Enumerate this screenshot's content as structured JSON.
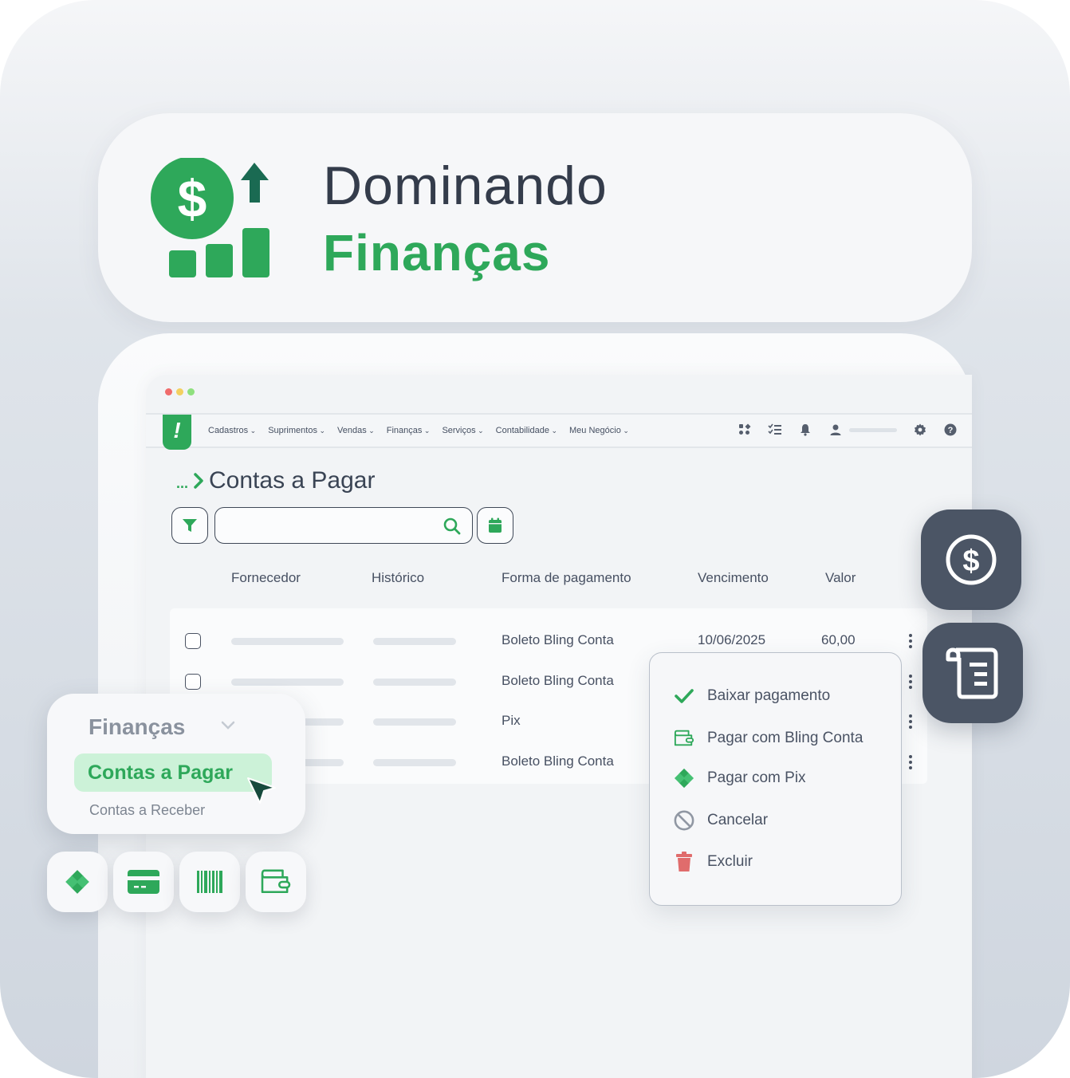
{
  "hero": {
    "title_line1": "Dominando",
    "title_line2": "Finanças"
  },
  "window": {
    "nav": [
      "Cadastros",
      "Suprimentos",
      "Vendas",
      "Finanças",
      "Serviços",
      "Contabilidade",
      "Meu Negócio"
    ],
    "logo_glyph": "!"
  },
  "page": {
    "breadcrumb_ellipsis": "...",
    "title": "Contas a Pagar",
    "search_placeholder": ""
  },
  "table": {
    "columns": [
      "Fornecedor",
      "Histórico",
      "Forma de pagamento",
      "Vencimento",
      "Valor"
    ],
    "rows": [
      {
        "payment": "Boleto Bling Conta",
        "due": "10/06/2025",
        "value": "60,00"
      },
      {
        "payment": "Boleto Bling Conta",
        "due": "",
        "value": ""
      },
      {
        "payment": "Pix",
        "due": "",
        "value": ""
      },
      {
        "payment": "Boleto Bling Conta",
        "due": "",
        "value": ""
      }
    ]
  },
  "menu": {
    "items": [
      {
        "label": "Baixar pagamento",
        "icon": "check-icon"
      },
      {
        "label": "Pagar com Bling Conta",
        "icon": "wallet-icon"
      },
      {
        "label": "Pagar com Pix",
        "icon": "pix-icon"
      },
      {
        "label": "Cancelar",
        "icon": "cancel-icon"
      },
      {
        "label": "Excluir",
        "icon": "trash-icon"
      }
    ]
  },
  "sidebar": {
    "section": "Finanças",
    "active_item": "Contas a Pagar",
    "item2": "Contas a Receber"
  },
  "colors": {
    "brand_green": "#2ea85a",
    "dark_slate": "#4b5565",
    "danger": "#e06c6c"
  }
}
